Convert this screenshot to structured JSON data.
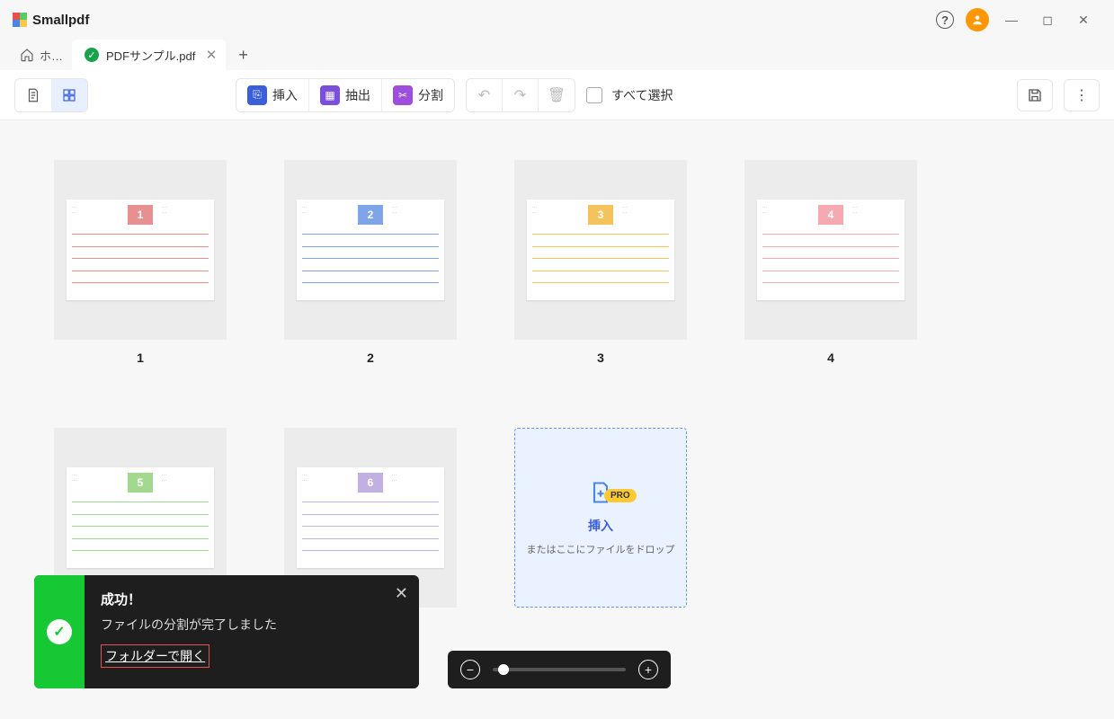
{
  "app": {
    "name": "Smallpdf"
  },
  "tabs": {
    "home": "ホ…",
    "document": "PDFサンプル.pdf"
  },
  "toolbar": {
    "insert": "挿入",
    "extract": "抽出",
    "split": "分割",
    "select_all": "すべて選択"
  },
  "pages": [
    {
      "num": "1",
      "month": "1"
    },
    {
      "num": "2",
      "month": "2"
    },
    {
      "num": "3",
      "month": "3"
    },
    {
      "num": "4",
      "month": "4"
    },
    {
      "num": "5",
      "month": "5"
    },
    {
      "num": "6",
      "month": "6"
    }
  ],
  "dropzone": {
    "pro": "PRO",
    "title": "挿入",
    "subtitle": "またはここにファイルをドロップ"
  },
  "toast": {
    "title": "成功！",
    "message": "ファイルの分割が完了しました",
    "link": "フォルダーで開く"
  }
}
